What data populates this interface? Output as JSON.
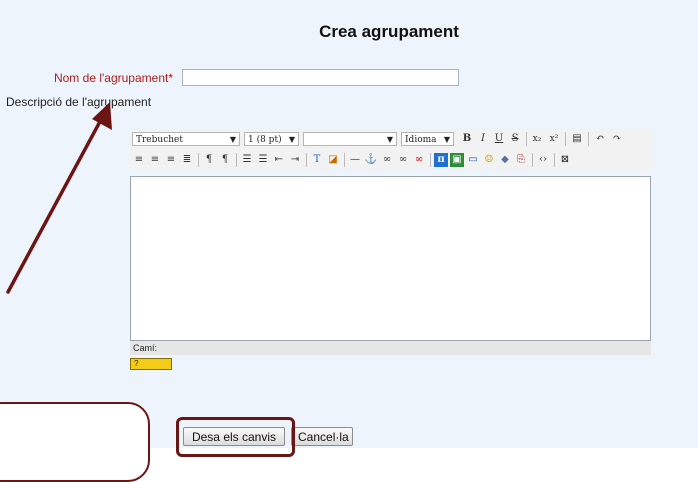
{
  "page": {
    "title": "Crea agrupament"
  },
  "form": {
    "name_label": "Nom de l'agrupament",
    "required_mark": "*",
    "name_value": "",
    "description_label": "Descripció de l'agrupament"
  },
  "editor": {
    "font_family": "Trebuchet",
    "font_size": "1 (8 pt)",
    "style": "",
    "language": "Idioma",
    "path_label": "Camí:"
  },
  "buttons": {
    "save_label": "Desa els canvis",
    "cancel_label": "Cancel·la"
  },
  "colors": {
    "panel_bg": "#eef4fb",
    "required_label": "#aa1f1f",
    "annotation": "#6b1515"
  }
}
